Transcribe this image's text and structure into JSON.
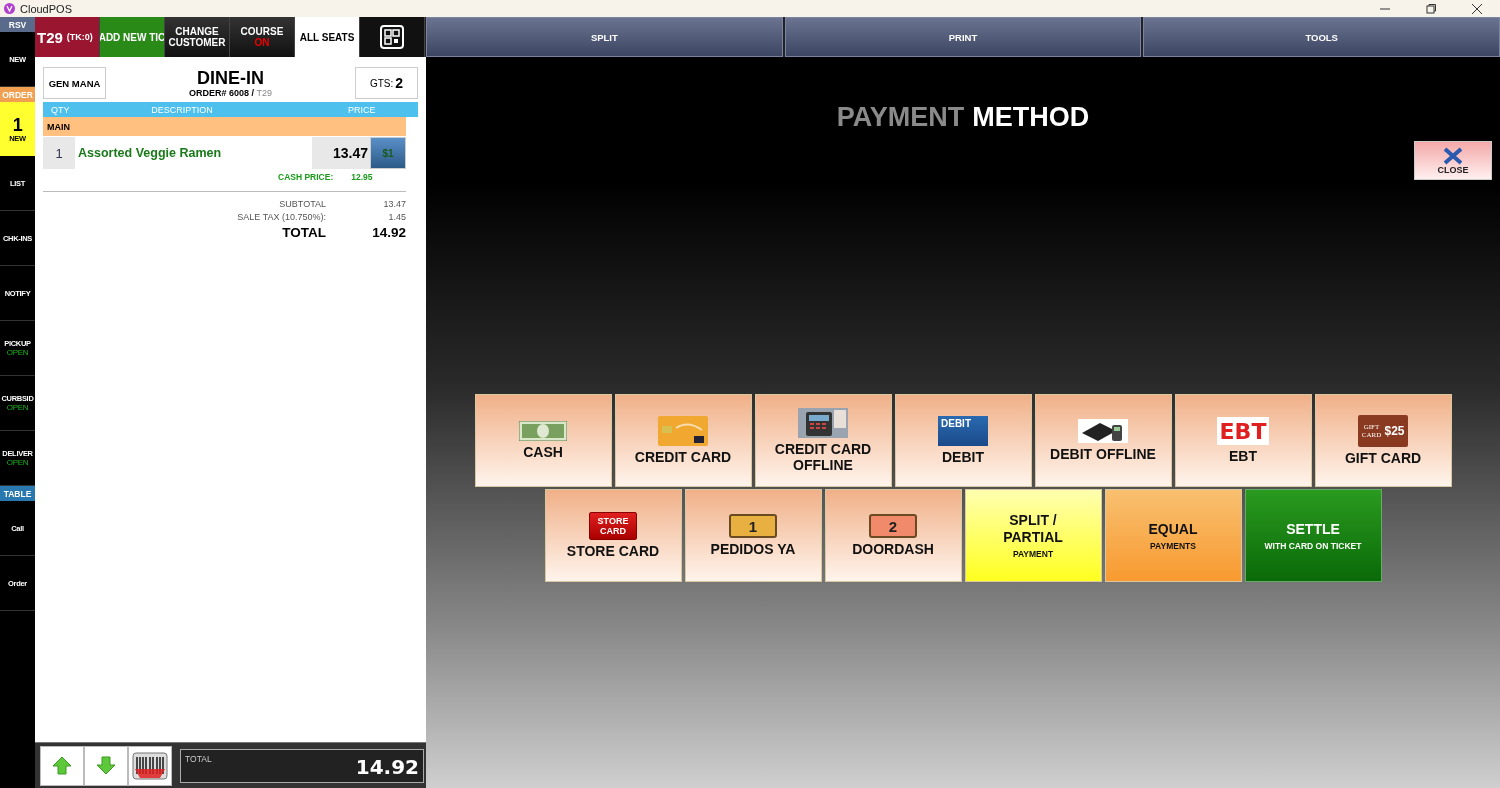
{
  "window": {
    "title": "CloudPOS"
  },
  "sidebar": [
    {
      "kind": "header",
      "label": "RSV",
      "color": "#5a6a8a"
    },
    {
      "kind": "item",
      "label": "NEW"
    },
    {
      "kind": "header",
      "label": "ORDER",
      "color": "#f0a050"
    },
    {
      "kind": "count",
      "count": "1",
      "label": "NEW"
    },
    {
      "kind": "item",
      "label": "LIST"
    },
    {
      "kind": "item",
      "label": "CHK-INS"
    },
    {
      "kind": "item",
      "label": "NOTIFY"
    },
    {
      "kind": "item",
      "label": "PICKUP",
      "status": "OPEN"
    },
    {
      "kind": "item",
      "label": "CURBSID",
      "status": "OPEN"
    },
    {
      "kind": "item",
      "label": "DELIVER",
      "status": "OPEN"
    },
    {
      "kind": "header",
      "label": "TABLE",
      "color": "#2a78b0"
    },
    {
      "kind": "item",
      "label": "Call"
    },
    {
      "kind": "item",
      "label": "Order"
    }
  ],
  "toolbar": [
    {
      "kind": "table",
      "label": "T29",
      "sub": "(TK:0)"
    },
    {
      "kind": "add",
      "label": "ADD NEW TIC"
    },
    {
      "kind": "dark",
      "label": "CHANGE CUSTOMER"
    },
    {
      "kind": "dark",
      "label": "COURSE",
      "sub": "ON"
    },
    {
      "kind": "light",
      "label": "ALL SEATS"
    },
    {
      "kind": "qr"
    }
  ],
  "tabs": [
    {
      "label": "SPLIT"
    },
    {
      "label": "PRINT"
    },
    {
      "label": "TOOLS"
    }
  ],
  "order": {
    "server": "GEN MANA",
    "type": "DINE-IN",
    "number": "ORDER# 6008 /",
    "table": "T29",
    "guests_label": "GTS:",
    "guests": "2",
    "columns": [
      "QTY",
      "DESCRIPTION",
      "PRICE"
    ],
    "section": "MAIN",
    "items": [
      {
        "qty": "1",
        "name": "Assorted Veggie Ramen",
        "price": "13.47",
        "seat": "$1",
        "cash_label": "CASH PRICE:",
        "cash_price": "12.95"
      }
    ],
    "totals": [
      {
        "kind": "line",
        "label": "SUBTOTAL",
        "value": "13.47"
      },
      {
        "kind": "line",
        "label": "SALE TAX (10.750%):",
        "value": "1.45"
      },
      {
        "kind": "grand",
        "label": "TOTAL",
        "value": "14.92"
      }
    ]
  },
  "footer": {
    "total_label": "TOTAL",
    "total": "14.92"
  },
  "payment": {
    "title_dim": "PAYMENT",
    "title_bright": "METHOD",
    "close": "CLOSE",
    "rows": [
      [
        {
          "kind": "cash",
          "label": "CASH"
        },
        {
          "kind": "credit",
          "label": "CREDIT CARD"
        },
        {
          "kind": "terminal",
          "label": "CREDIT CARD OFFLINE"
        },
        {
          "kind": "debit",
          "icon_text": [
            "DEBIT"
          ],
          "label": "DEBIT"
        },
        {
          "kind": "reader",
          "label": "DEBIT OFFLINE"
        },
        {
          "kind": "ebt",
          "icon_text": [
            "EBT"
          ],
          "label": "EBT"
        },
        {
          "kind": "gift",
          "icon_text": [
            "GIFT CARD",
            "$25"
          ],
          "label": "GIFT CARD"
        }
      ],
      [
        {
          "kind": "store",
          "icon_text": [
            "STORE CARD"
          ],
          "label": "STORE CARD"
        },
        {
          "kind": "ticket",
          "icon_text": [
            "1"
          ],
          "color": "#e8b040",
          "label": "PEDIDOS YA"
        },
        {
          "kind": "ticket",
          "icon_text": [
            "2"
          ],
          "color": "#f08a6a",
          "label": "DOORDASH"
        },
        {
          "kind": "split",
          "label": "SPLIT / PARTIAL",
          "sub": "PAYMENT"
        },
        {
          "kind": "equal",
          "label": "EQUAL",
          "sub": "PAYMENTS"
        },
        {
          "kind": "settle",
          "label": "SETTLE",
          "sub": "WITH CARD ON TICKET"
        }
      ]
    ]
  }
}
